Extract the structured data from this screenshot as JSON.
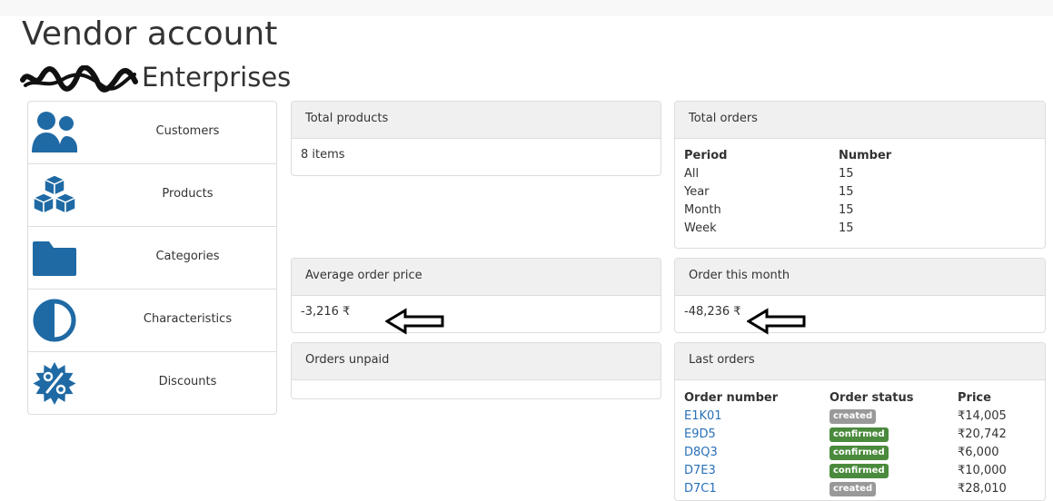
{
  "page": {
    "title": "Vendor account",
    "vendor_name": "Enterprises"
  },
  "colors": {
    "icon_blue": "#1f6aa5",
    "link_blue": "#2a70b8",
    "badge_created": "#999999",
    "badge_confirmed": "#4a8a3c"
  },
  "sidebar": {
    "items": [
      {
        "label": "Customers",
        "icon": "users-icon"
      },
      {
        "label": "Products",
        "icon": "cubes-icon"
      },
      {
        "label": "Categories",
        "icon": "folder-icon"
      },
      {
        "label": "Characteristics",
        "icon": "adjust-icon"
      },
      {
        "label": "Discounts",
        "icon": "percent-badge-icon"
      }
    ]
  },
  "total_products": {
    "heading": "Total products",
    "value": "8 items"
  },
  "total_orders": {
    "heading": "Total orders",
    "columns": [
      "Period",
      "Number"
    ],
    "rows": [
      {
        "period": "All",
        "number": "15"
      },
      {
        "period": "Year",
        "number": "15"
      },
      {
        "period": "Month",
        "number": "15"
      },
      {
        "period": "Week",
        "number": "15"
      }
    ]
  },
  "average_order_price": {
    "heading": "Average order price",
    "value": "-3,216 ₹"
  },
  "order_this_month": {
    "heading": "Order this month",
    "value": "-48,236 ₹"
  },
  "orders_unpaid": {
    "heading": "Orders unpaid"
  },
  "last_orders": {
    "heading": "Last orders",
    "columns": [
      "Order number",
      "Order status",
      "Price"
    ],
    "rows": [
      {
        "number": "E1K01",
        "status": "created",
        "price": "₹14,005"
      },
      {
        "number": "E9D5",
        "status": "confirmed",
        "price": "₹20,742"
      },
      {
        "number": "D8Q3",
        "status": "confirmed",
        "price": "₹6,000"
      },
      {
        "number": "D7E3",
        "status": "confirmed",
        "price": "₹10,000"
      },
      {
        "number": "D7C1",
        "status": "created",
        "price": "₹28,010"
      }
    ]
  }
}
